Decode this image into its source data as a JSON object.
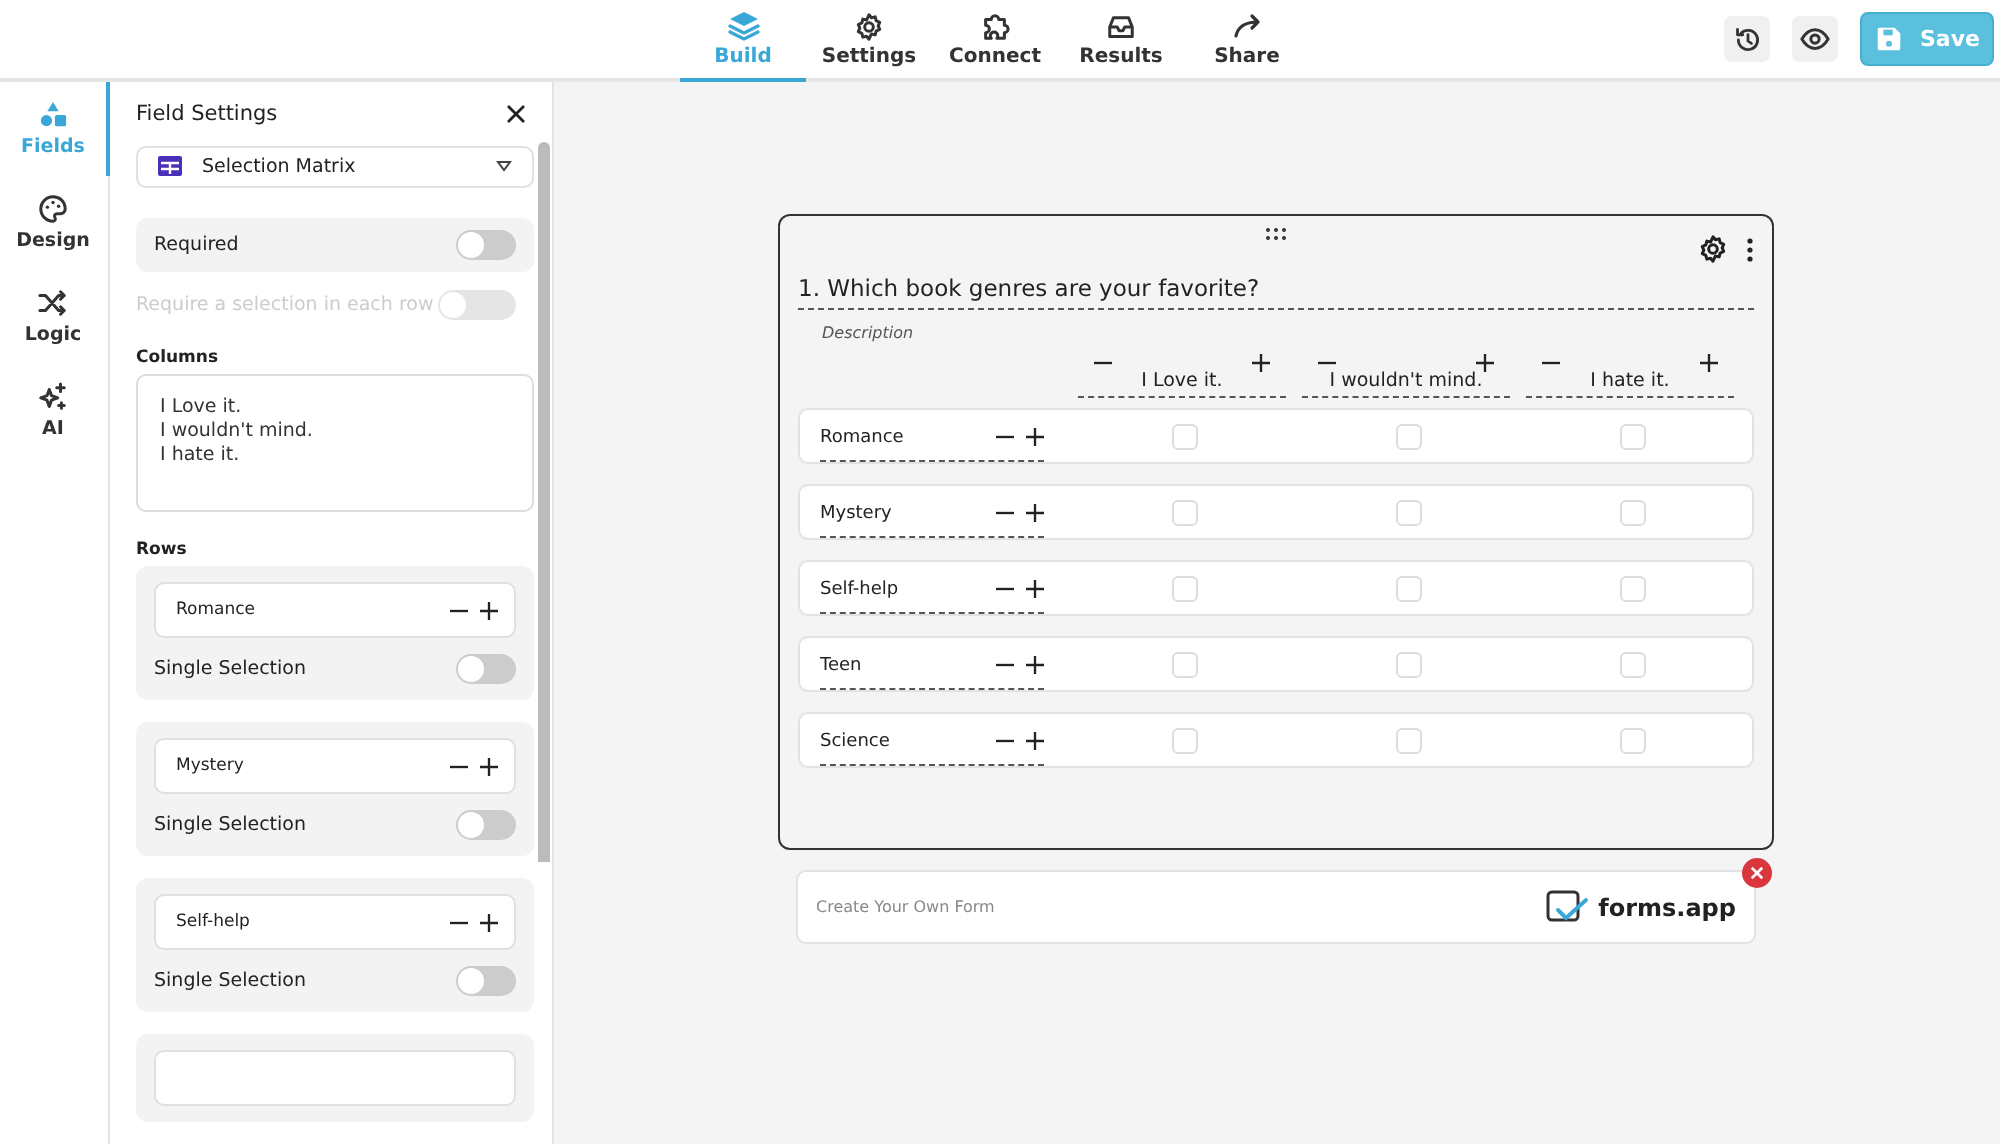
{
  "top_tabs": [
    {
      "label": "Build",
      "selected": true
    },
    {
      "label": "Settings",
      "selected": false
    },
    {
      "label": "Connect",
      "selected": false
    },
    {
      "label": "Results",
      "selected": false
    },
    {
      "label": "Share",
      "selected": false
    }
  ],
  "save_button": "Save",
  "side_nav": [
    {
      "label": "Fields",
      "selected": true
    },
    {
      "label": "Design",
      "selected": false
    },
    {
      "label": "Logic",
      "selected": false
    },
    {
      "label": "AI",
      "selected": false
    }
  ],
  "field_settings": {
    "title": "Field Settings",
    "field_type": "Selection Matrix",
    "toggles": [
      {
        "label": "Required",
        "on": false,
        "disabled": false
      },
      {
        "label": "Require a selection in each row",
        "on": false,
        "disabled": true
      }
    ],
    "columns_label": "Columns",
    "columns_text": "I Love it.\nI wouldn't mind.\nI hate it.",
    "rows_label": "Rows",
    "rows": [
      {
        "name": "Romance",
        "toggle_label": "Single Selection",
        "on": false
      },
      {
        "name": "Mystery",
        "toggle_label": "Single Selection",
        "on": false
      },
      {
        "name": "Self-help",
        "toggle_label": "Single Selection",
        "on": false
      }
    ]
  },
  "question": {
    "title": "1. Which book genres are your favorite?",
    "description": "Description",
    "columns": [
      "I Love it.",
      "I wouldn't mind.",
      "I hate it."
    ],
    "rows": [
      {
        "label": "Romance",
        "cells": [
          false,
          false,
          false
        ]
      },
      {
        "label": "Mystery",
        "cells": [
          false,
          false,
          false
        ]
      },
      {
        "label": "Self-help",
        "cells": [
          false,
          false,
          false
        ]
      },
      {
        "label": "Teen",
        "cells": [
          false,
          false,
          false
        ]
      },
      {
        "label": "Science",
        "cells": [
          false,
          false,
          false
        ]
      }
    ]
  },
  "branding": {
    "text": "Create Your Own Form",
    "logo": "forms.app"
  }
}
